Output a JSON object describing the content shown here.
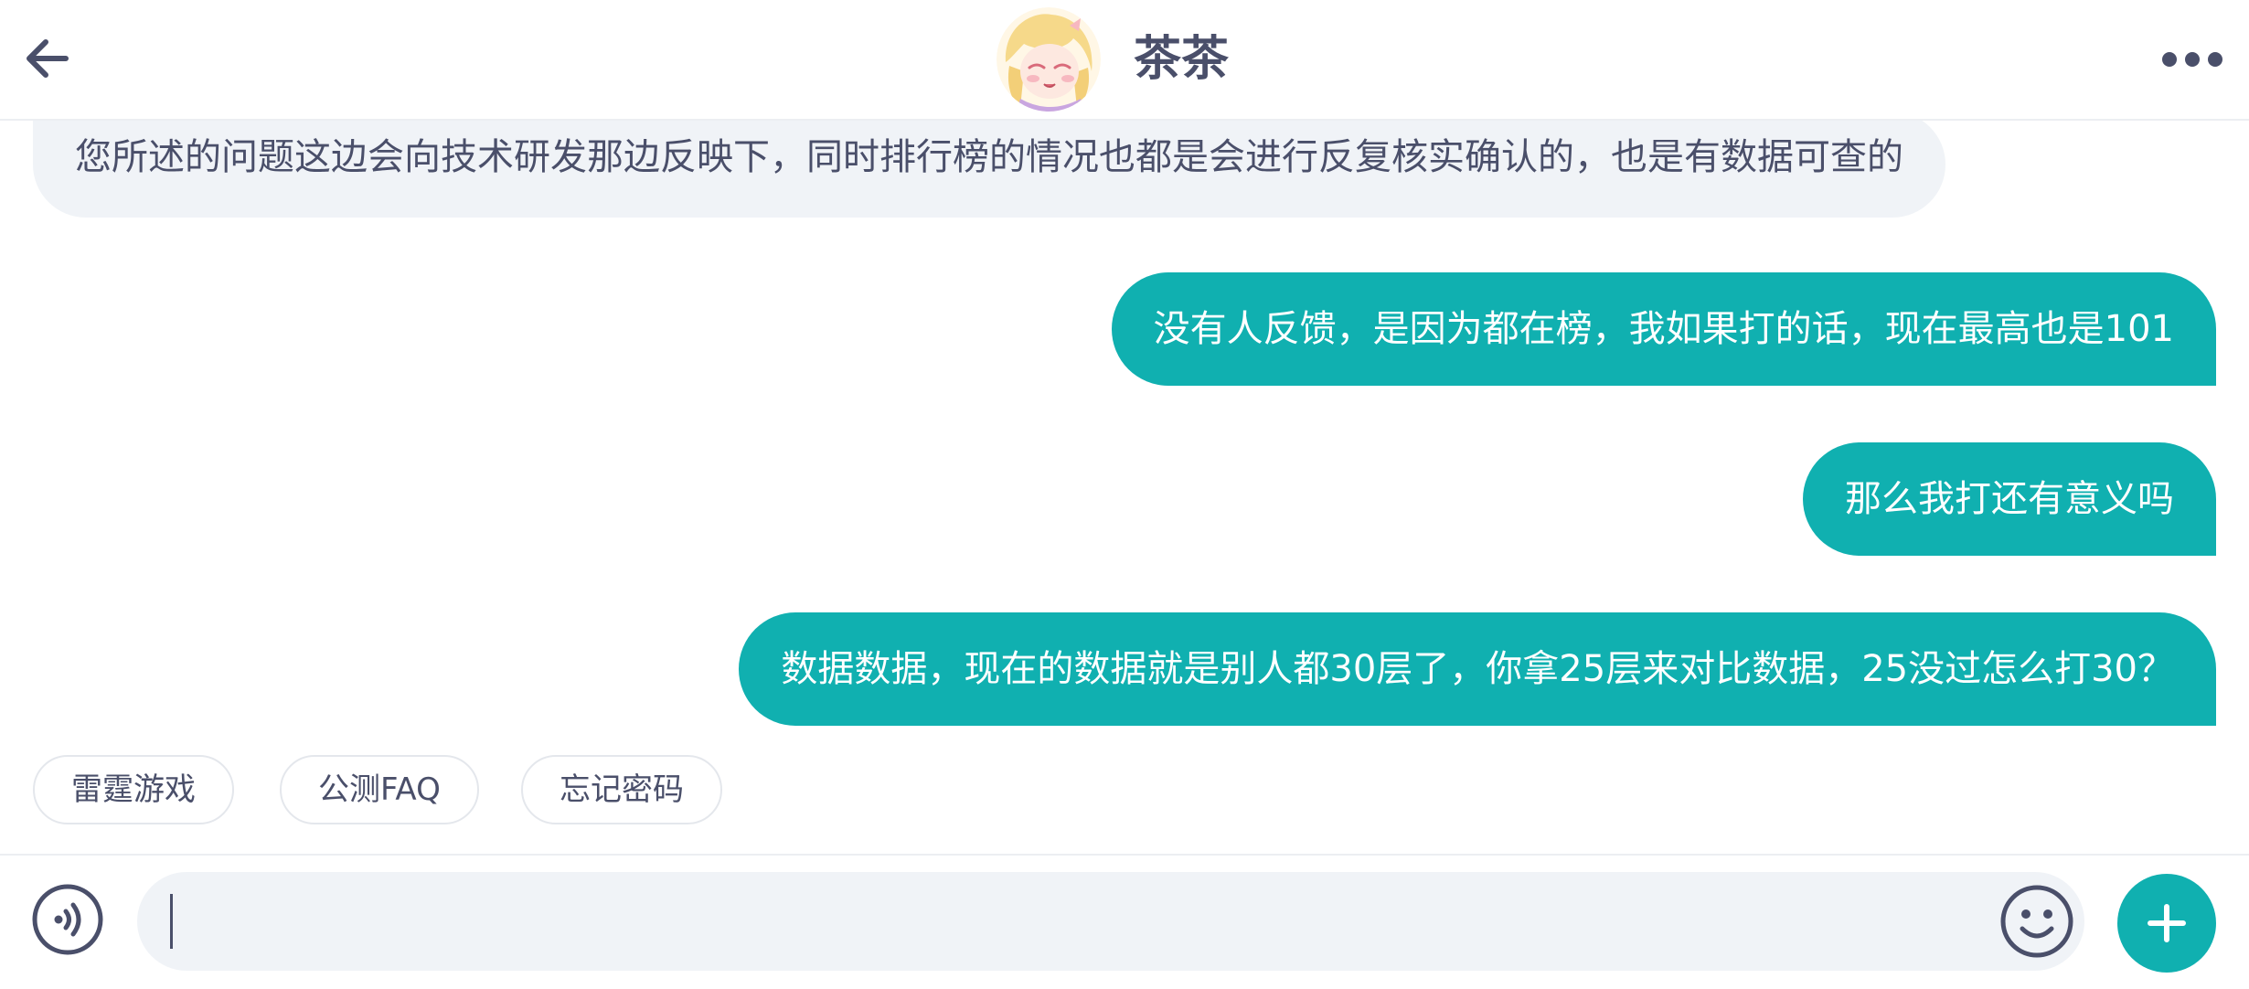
{
  "header": {
    "title": "茶茶",
    "back_icon": "arrow-left-icon",
    "more_icon": "more-horizontal-icon",
    "avatar": "anime-girl-avatar"
  },
  "messages": [
    {
      "direction": "incoming",
      "text": "您所述的问题这边会向技术研发那边反映下，同时排行榜的情况也都是会进行反复核实确认的，也是有数据可查的"
    },
    {
      "direction": "outgoing",
      "text": "没有人反馈，是因为都在榜，我如果打的话，现在最高也是101"
    },
    {
      "direction": "outgoing",
      "text": "那么我打还有意义吗"
    },
    {
      "direction": "outgoing",
      "text": "数据数据，现在的数据就是别人都30层了，你拿25层来对比数据，25没过怎么打30？"
    }
  ],
  "quick_replies": [
    "雷霆游戏",
    "公测FAQ",
    "忘记密码"
  ],
  "input": {
    "value": "",
    "placeholder": "",
    "voice_icon": "voice-input-icon",
    "emoji_icon": "emoji-icon",
    "plus_icon": "plus-icon"
  },
  "colors": {
    "accent": "#10b0b0",
    "incoming_bubble": "#f0f3f7",
    "text": "#4a4f6a",
    "background": "#ffffff"
  }
}
